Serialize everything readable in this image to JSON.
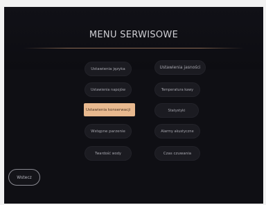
{
  "title": "MENU SERWISOWE",
  "buttons": [
    {
      "label": "Ustawienia języka"
    },
    {
      "label": "Ustawienia jasności"
    },
    {
      "label": "Ustawienia napojów"
    },
    {
      "label": "Temperatura kawy"
    },
    {
      "label": "Ustawienia konserwacji"
    },
    {
      "label": "Statystyki"
    },
    {
      "label": "Wstępne parzenie"
    },
    {
      "label": "Alarmy akustyczne"
    },
    {
      "label": "Twardość wody"
    },
    {
      "label": "Czas czuwania"
    }
  ],
  "back_label": "Wstecz",
  "colors": {
    "active": "#e8b98f",
    "accent_line": "#8a6a52",
    "background": "#0f0f14"
  }
}
